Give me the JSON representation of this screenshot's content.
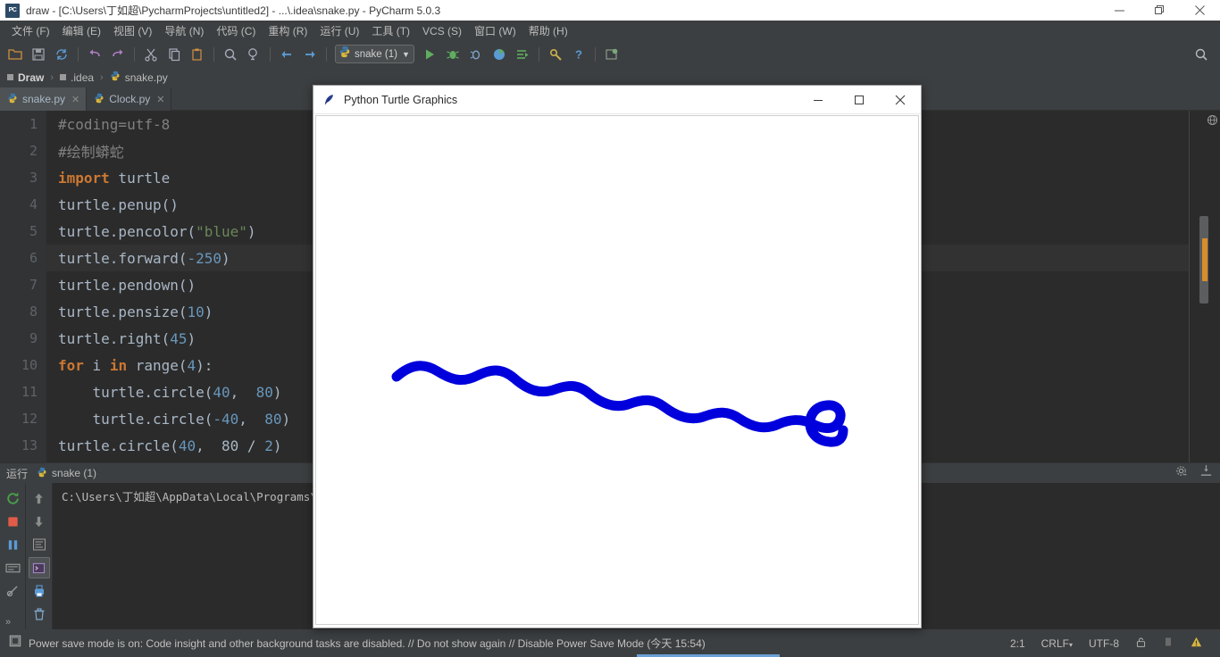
{
  "window": {
    "title": "draw - [C:\\Users\\丁如超\\PycharmProjects\\untitled2] - ...\\.idea\\snake.py - PyCharm 5.0.3",
    "app_icon": "pycharm-icon",
    "minimize": "−",
    "maximize": "❐",
    "close": "✕"
  },
  "menubar": {
    "items": [
      {
        "label": "文件 (F)",
        "name": "menu-file"
      },
      {
        "label": "编辑 (E)",
        "name": "menu-edit"
      },
      {
        "label": "视图 (V)",
        "name": "menu-view"
      },
      {
        "label": "导航 (N)",
        "name": "menu-navigate"
      },
      {
        "label": "代码 (C)",
        "name": "menu-code"
      },
      {
        "label": "重构 (R)",
        "name": "menu-refactor"
      },
      {
        "label": "运行 (U)",
        "name": "menu-run"
      },
      {
        "label": "工具 (T)",
        "name": "menu-tools"
      },
      {
        "label": "VCS (S)",
        "name": "menu-vcs"
      },
      {
        "label": "窗口 (W)",
        "name": "menu-window"
      },
      {
        "label": "帮助 (H)",
        "name": "menu-help"
      }
    ]
  },
  "toolbar": {
    "run_config_label": "snake (1)",
    "run_config_dropdown": "▼",
    "icons": [
      "open-folder-icon",
      "save-all-icon",
      "sync-icon",
      "undo-icon",
      "redo-icon",
      "cut-icon",
      "copy-icon",
      "paste-icon",
      "find-icon",
      "replace-icon",
      "back-icon",
      "forward-icon"
    ],
    "run_icons": [
      "run-icon",
      "debug-icon",
      "debug-coverage-icon",
      "profile-icon",
      "run-with-console-icon"
    ],
    "right_icons": [
      "settings-icon",
      "help-icon",
      "sync-project-icon"
    ],
    "search_icon": "search-icon"
  },
  "breadcrumb": {
    "items": [
      {
        "label": "Draw",
        "name": "breadcrumb-project"
      },
      {
        "label": ".idea",
        "name": "breadcrumb-idea"
      },
      {
        "label": "snake.py",
        "name": "breadcrumb-file"
      }
    ],
    "separator": "›"
  },
  "tabs": [
    {
      "label": "snake.py",
      "active": true,
      "close": "✕",
      "name": "tab-snake-py"
    },
    {
      "label": "Clock.py",
      "active": false,
      "close": "✕",
      "name": "tab-clock-py"
    }
  ],
  "editor": {
    "line_numbers": [
      "1",
      "2",
      "3",
      "4",
      "5",
      "6",
      "7",
      "8",
      "9",
      "10",
      "11",
      "12",
      "13"
    ],
    "caret_line_index": 5,
    "lines": [
      [
        {
          "t": "#coding=utf-8",
          "c": "comment"
        }
      ],
      [
        {
          "t": "#绘制蟒蛇",
          "c": "comment"
        }
      ],
      [
        {
          "t": "import",
          "c": "kw"
        },
        {
          "t": " turtle",
          "c": "plain"
        }
      ],
      [
        {
          "t": "turtle.penup()",
          "c": "plain"
        }
      ],
      [
        {
          "t": "turtle.pencolor(",
          "c": "plain"
        },
        {
          "t": "\"blue\"",
          "c": "str"
        },
        {
          "t": ")",
          "c": "plain"
        }
      ],
      [
        {
          "t": "turtle.forward(",
          "c": "plain"
        },
        {
          "t": "-250",
          "c": "num"
        },
        {
          "t": ")",
          "c": "plain"
        }
      ],
      [
        {
          "t": "turtle.pendown()",
          "c": "plain"
        }
      ],
      [
        {
          "t": "turtle.pensize(",
          "c": "plain"
        },
        {
          "t": "10",
          "c": "num"
        },
        {
          "t": ")",
          "c": "plain"
        }
      ],
      [
        {
          "t": "turtle.right(",
          "c": "plain"
        },
        {
          "t": "45",
          "c": "num"
        },
        {
          "t": ")",
          "c": "plain"
        }
      ],
      [
        {
          "t": "for",
          "c": "kw"
        },
        {
          "t": " i ",
          "c": "plain"
        },
        {
          "t": "in",
          "c": "kw"
        },
        {
          "t": " range(",
          "c": "plain"
        },
        {
          "t": "4",
          "c": "num"
        },
        {
          "t": "):",
          "c": "plain"
        }
      ],
      [
        {
          "t": "    turtle.circle(",
          "c": "plain"
        },
        {
          "t": "40",
          "c": "num"
        },
        {
          "t": ",  ",
          "c": "plain"
        },
        {
          "t": "80",
          "c": "num"
        },
        {
          "t": ")",
          "c": "plain"
        }
      ],
      [
        {
          "t": "    turtle.circle(",
          "c": "plain"
        },
        {
          "t": "-40",
          "c": "num"
        },
        {
          "t": ",  ",
          "c": "plain"
        },
        {
          "t": "80",
          "c": "num"
        },
        {
          "t": ")",
          "c": "plain"
        }
      ],
      [
        {
          "t": "turtle.circle(",
          "c": "plain"
        },
        {
          "t": "40",
          "c": "num"
        },
        {
          "t": ",  ",
          "c": "plain"
        },
        {
          "t": "80",
          "c": "plain"
        },
        {
          "t": " / ",
          "c": "plain"
        },
        {
          "t": "2",
          "c": "num"
        },
        {
          "t": ")",
          "c": "plain"
        }
      ]
    ],
    "globe_icon": "globe-icon"
  },
  "run_window": {
    "title": "运行",
    "tab_label": "snake (1)",
    "tab_icon": "python-file-icon",
    "console_text": "C:\\Users\\丁如超\\AppData\\Local\\Programs\\Python\\",
    "sidebar_icons": [
      "rerun-icon",
      "stop-icon",
      "pause-icon",
      "keyboard-icon",
      "pin-icon"
    ],
    "sidebar2_icons": [
      "scroll-up-icon",
      "scroll-down-icon",
      "soft-wrap-icon",
      "console-icon",
      "print-icon",
      "trash-icon"
    ],
    "header_icons": [
      "gear-icon",
      "hide-icon"
    ]
  },
  "statusbar": {
    "expand_icon": "»",
    "layout_icon": "layout-icon",
    "message": "Power save mode is on: Code insight and other background tasks are disabled. // Do not show again // Disable Power Save Mode (今天 15:54)",
    "caret_position": "2:1",
    "line_separator": "CRLF",
    "line_separator_arrow": "⌄",
    "encoding": "UTF-8",
    "lock_icon": "unlock-icon",
    "memory_icon": "memory-icon",
    "notification_icon": "notification-warning-icon"
  },
  "turtle_window": {
    "title": "Python Turtle Graphics",
    "icon": "feather-icon",
    "minimize": "−",
    "maximize": "□",
    "close": "✕",
    "canvas": {
      "background": "#ffffff",
      "pen_color": "#0000dd",
      "pen_size": 10,
      "drawing_name": "snake-curve"
    }
  },
  "colors": {
    "ide_chrome": "#3c3f41",
    "editor_bg": "#2b2b2b",
    "gutter_bg": "#313335",
    "text": "#a9b7c6",
    "keyword": "#cc7832",
    "string": "#6a8759",
    "number": "#6897bb",
    "comment": "#808080",
    "accent_blue": "#0000dd",
    "progress_blue": "#6a9fd4"
  }
}
